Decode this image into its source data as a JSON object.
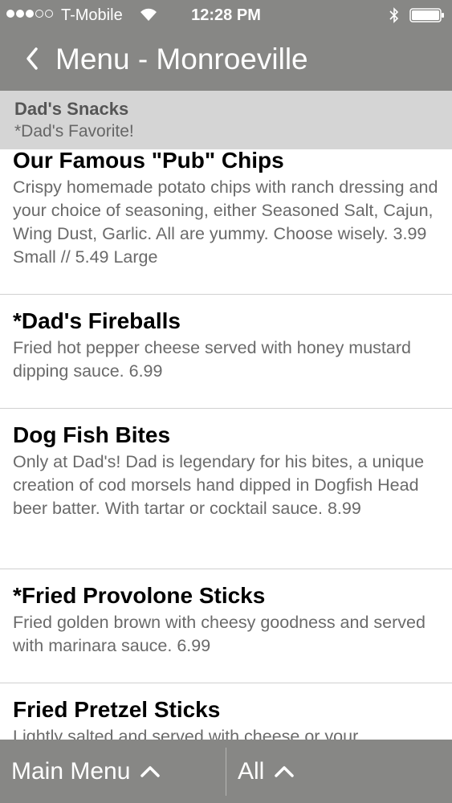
{
  "status_bar": {
    "carrier": "T-Mobile",
    "time": "12:28 PM"
  },
  "nav": {
    "title": "Menu - Monroeville"
  },
  "section": {
    "title": "Dad's Snacks",
    "subtitle": "*Dad's Favorite!"
  },
  "items": [
    {
      "name": "Our Famous \"Pub\" Chips",
      "description": "Crispy homemade potato chips with ranch dressing and your choice of seasoning, either Seasoned Salt, Cajun, Wing Dust, Garlic. All are yummy. Choose wisely. 3.99 Small // 5.49 Large"
    },
    {
      "name": "*Dad's Fireballs",
      "description": "Fried hot pepper cheese served with honey mustard dipping sauce. 6.99"
    },
    {
      "name": "Dog Fish Bites",
      "description": "Only at Dad's! Dad is legendary for his bites, a unique creation of cod morsels hand dipped in Dogfish Head beer batter. With tartar or cocktail sauce. 8.99"
    },
    {
      "name": "*Fried Provolone Sticks",
      "description": "Fried golden brown with cheesy goodness and served with marinara sauce. 6.99"
    },
    {
      "name": "Fried Pretzel Sticks",
      "description": "Lightly salted and served with cheese or your"
    }
  ],
  "footer": {
    "main_menu_label": "Main Menu",
    "all_label": "All"
  }
}
